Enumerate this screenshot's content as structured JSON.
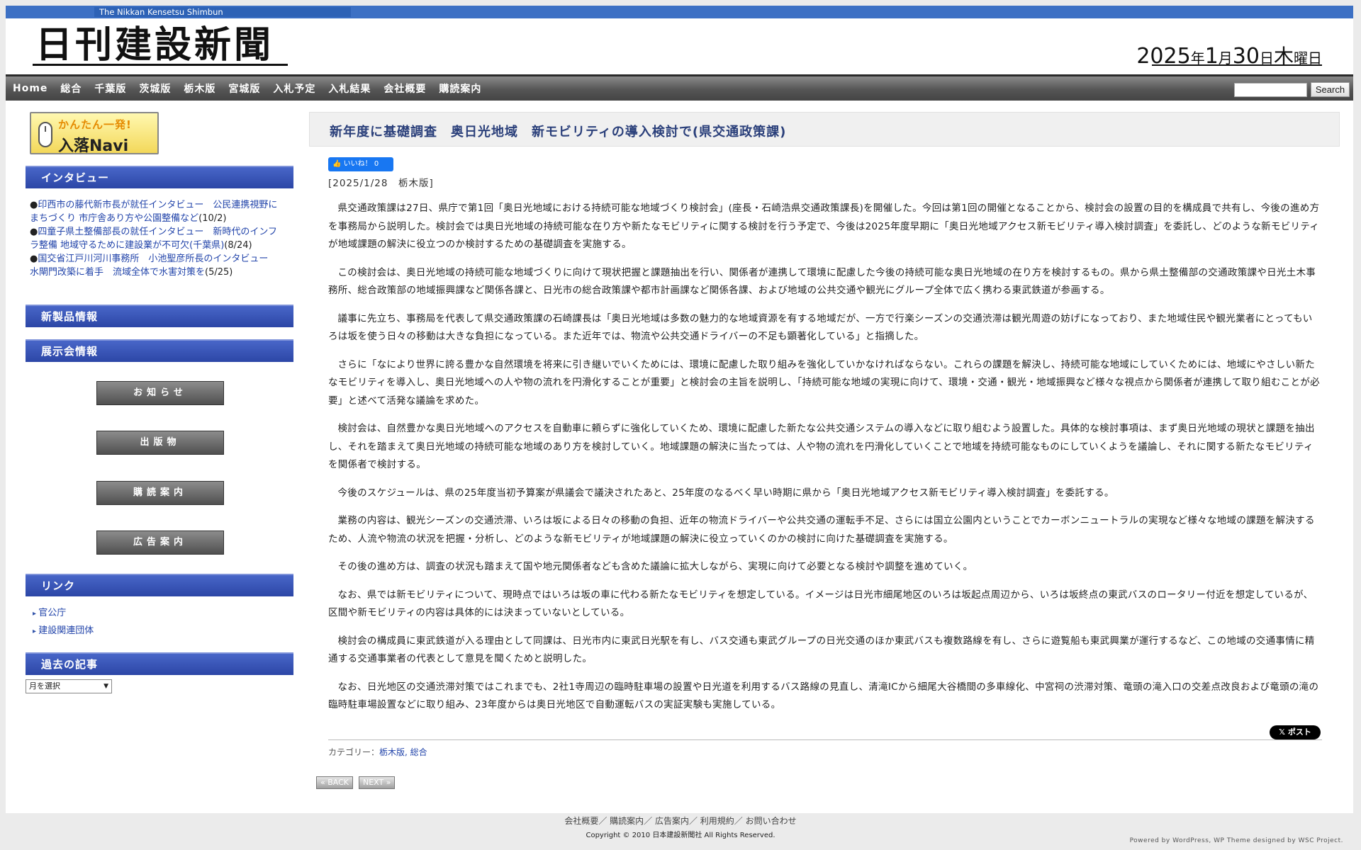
{
  "header": {
    "english_title": "The   Nikkan   Kensetsu   Shimbun",
    "logo": "日刊建設新聞",
    "date": {
      "year": "2025",
      "y_kanji": "年",
      "month": "1",
      "m_kanji": "月",
      "day": "30",
      "d_kanji": "日",
      "dow": "木",
      "dow_suffix": "曜日"
    }
  },
  "nav": {
    "items": [
      "Home",
      "総合",
      "千葉版",
      "茨城版",
      "栃木版",
      "宮城版",
      "入札予定",
      "入札結果",
      "会社概要",
      "購読案内"
    ],
    "search_button": "Search",
    "search_placeholder": ""
  },
  "sidebar": {
    "banner_top": "かんたん一発!",
    "banner_bottom": "入落Navi",
    "interview_heading": "インタビュー",
    "interviews": [
      {
        "text": "印西市の藤代新市長が就任インタビュー　公民連携視野にまちづくり 市庁舎あり方や公園整備など",
        "date": "(10/2)"
      },
      {
        "text": "四童子県土整備部長の就任インタビュー　新時代のインフラ整備 地域守るために建設業が不可欠(千葉県)",
        "date": "(8/24)"
      },
      {
        "text": "国交省江戸川河川事務所　小池聖彦所長のインタビュー　水閘門改築に着手　流域全体で水害対策を",
        "date": "(5/25)"
      }
    ],
    "new_products_heading": "新製品情報",
    "exhibition_heading": "展示会情報",
    "buttons": [
      "お知らせ",
      "出版物",
      "購読案内",
      "広告案内"
    ],
    "links_heading": "リンク",
    "links": [
      "官公庁",
      "建設関連団体"
    ],
    "archive_heading": "過去の記事",
    "month_select": "月を選択"
  },
  "article": {
    "title": "新年度に基礎調査　奥日光地域　新モビリティの導入検討で(県交通政策課)",
    "like_label": "いいね！ 0",
    "meta": "[2025/1/28　栃木版]",
    "paragraphs": [
      "県交通政策課は27日、県庁で第1回「奥日光地域における持続可能な地域づくり検討会」(座長・石崎浩県交通政策課長)を開催した。今回は第1回の開催となることから、検討会の設置の目的を構成員で共有し、今後の進め方を事務局から説明した。検討会では奥日光地域の持続可能な在り方や新たなモビリティに関する検討を行う予定で、今後は2025年度早期に「奥日光地域アクセス新モビリティ導入検討調査」を委託し、どのような新モビリティが地域課題の解決に役立つのか検討するための基礎調査を実施する。",
      "この検討会は、奥日光地域の持続可能な地域づくりに向けて現状把握と課題抽出を行い、関係者が連携して環境に配慮した今後の持続可能な奥日光地域の在り方を検討するもの。県から県土整備部の交通政策課や日光土木事務所、総合政策部の地域振興課など関係各課と、日光市の総合政策課や都市計画課など関係各課、および地域の公共交通や観光にグループ全体で広く携わる東武鉄道が参画する。",
      "議事に先立ち、事務局を代表して県交通政策課の石崎課長は「奥日光地域は多数の魅力的な地域資源を有する地域だが、一方で行楽シーズンの交通渋滞は観光周遊の妨げになっており、また地域住民や観光業者にとってもいろは坂を使う日々の移動は大きな負担になっている。また近年では、物流や公共交通ドライバーの不足も顕著化している」と指摘した。",
      "さらに「なにより世界に誇る豊かな自然環境を将来に引き継いでいくためには、環境に配慮した取り組みを強化していかなければならない。これらの課題を解決し、持続可能な地域にしていくためには、地域にやさしい新たなモビリティを導入し、奥日光地域への人や物の流れを円滑化することが重要」と検討会の主旨を説明し、「持続可能な地域の実現に向けて、環境・交通・観光・地域振興など様々な視点から関係者が連携して取り組むことが必要」と述べて活発な議論を求めた。",
      "検討会は、自然豊かな奥日光地域へのアクセスを自動車に頼らずに強化していくため、環境に配慮した新たな公共交通システムの導入などに取り組むよう設置した。具体的な検討事項は、まず奥日光地域の現状と課題を抽出し、それを踏まえて奥日光地域の持続可能な地域のあり方を検討していく。地域課題の解決に当たっては、人や物の流れを円滑化していくことで地域を持続可能なものにしていくようを議論し、それに関する新たなモビリティを関係者で検討する。",
      "今後のスケジュールは、県の25年度当初予算案が県議会で議決されたあと、25年度のなるべく早い時期に県から「奥日光地域アクセス新モビリティ導入検討調査」を委託する。",
      "業務の内容は、観光シーズンの交通渋滞、いろは坂による日々の移動の負担、近年の物流ドライバーや公共交通の運転手不足、さらには国立公園内ということでカーボンニュートラルの実現など様々な地域の課題を解決するため、人流や物流の状況を把握・分析し、どのような新モビリティが地域課題の解決に役立っていくのかの検討に向けた基礎調査を実施する。",
      "その後の進め方は、調査の状況も踏まえて国や地元関係者なども含めた議論に拡大しながら、実現に向けて必要となる検討や調整を進めていく。",
      "なお、県では新モビリティについて、現時点ではいろは坂の車に代わる新たなモビリティを想定している。イメージは日光市細尾地区のいろは坂起点周辺から、いろは坂終点の東武バスのロータリー付近を想定しているが、区間や新モビリティの内容は具体的には決まっていないとしている。",
      "検討会の構成員に東武鉄道が入る理由として同課は、日光市内に東武日光駅を有し、バス交通も東武グループの日光交通のほか東武バスも複数路線を有し、さらに遊覧船も東武興業が運行するなど、この地域の交通事情に精通する交通事業者の代表として意見を聞くためと説明した。",
      "なお、日光地区の交通渋滞対策ではこれまでも、2社1寺周辺の臨時駐車場の設置や日光道を利用するバス路線の見直し、清滝ICから細尾大谷橋間の多車線化、中宮祠の渋滞対策、竜頭の滝入口の交差点改良および竜頭の滝の臨時駐車場設置などに取り組み、23年度からは奥日光地区で自動運転バスの実証実験も実施している。"
    ],
    "post_label": "𝕏 ポスト",
    "category_label": "カテゴリー：",
    "categories": "栃木版, 総合",
    "back_label": "« BACK",
    "next_label": "NEXT »"
  },
  "footer": {
    "links": "会社概要／ 購読案内／ 広告案内／ 利用規約／ お問い合わせ",
    "copyright": "Copyright © 2010 日本建設新聞社 All Rights Reserved.",
    "powered": "Powered by WordPress, WP Theme designed by WSC Project."
  }
}
